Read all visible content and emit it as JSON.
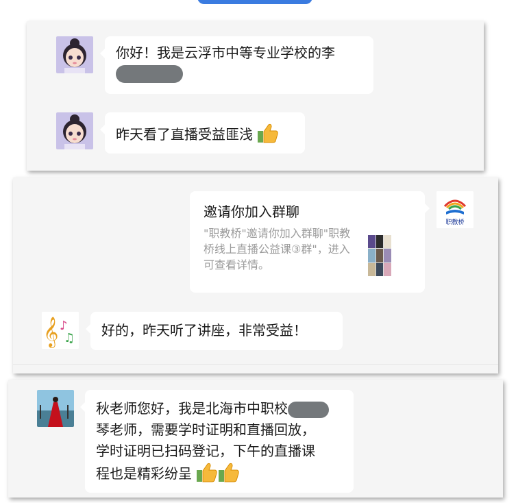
{
  "chat1": {
    "msg1_text": "你好！我是云浮市中等专业学校的李",
    "msg2_text": "昨天看了直播受益匪浅"
  },
  "chat2": {
    "invite_title": "邀请你加入群聊",
    "invite_desc": "\"职教桥\"邀请你加入群聊\"职教桥线上直播公益课③群\"，进入可查看详情。",
    "logo_text": "职教桥",
    "reply_text": "好的，昨天听了讲座，非常受益！"
  },
  "chat3": {
    "line1": "秋老师您好，我是北海市中职校",
    "line2": "琴老师，需要学时证明和直播回放，",
    "line3": "学时证明已扫码登记，下午的直播课",
    "line4": "程也是精彩纷呈"
  },
  "colors": {
    "card_bg": "#f5f5f5",
    "bubble_bg": "#ffffff",
    "redaction": "#74787b",
    "accent_tab": "#3a7be0"
  }
}
